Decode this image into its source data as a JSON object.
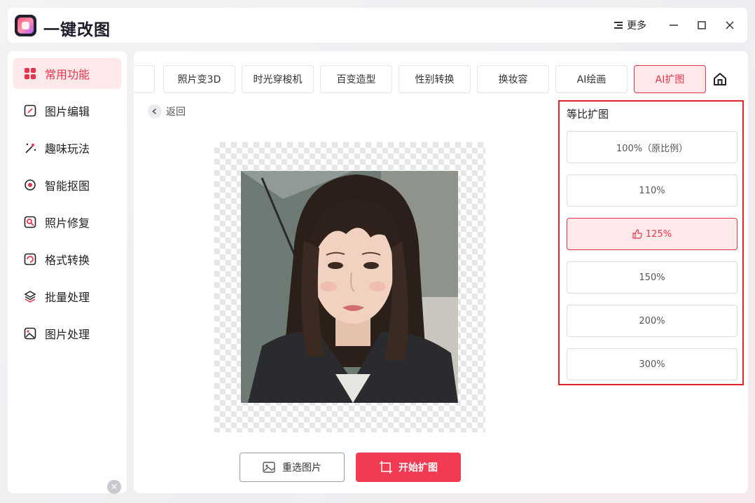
{
  "app": {
    "name": "一键改图",
    "more_label": "更多"
  },
  "sidebar": {
    "items": [
      {
        "label": "常用功能",
        "icon": "grid-icon",
        "active": true
      },
      {
        "label": "图片编辑",
        "icon": "edit-icon"
      },
      {
        "label": "趣味玩法",
        "icon": "magic-wand-icon"
      },
      {
        "label": "智能抠图",
        "icon": "target-icon"
      },
      {
        "label": "照片修复",
        "icon": "repair-icon"
      },
      {
        "label": "格式转换",
        "icon": "convert-icon"
      },
      {
        "label": "批量处理",
        "icon": "layers-icon"
      },
      {
        "label": "图片处理",
        "icon": "image-icon"
      }
    ]
  },
  "tabs": [
    {
      "label": "照片变3D"
    },
    {
      "label": "时光穿梭机"
    },
    {
      "label": "百变造型"
    },
    {
      "label": "性别转换"
    },
    {
      "label": "换妆容"
    },
    {
      "label": "AI绘画"
    },
    {
      "label": "AI扩图",
      "active": true
    }
  ],
  "back_label": "返回",
  "buttons": {
    "reselect": "重选图片",
    "start": "开始扩图"
  },
  "ratio_panel": {
    "title": "等比扩图",
    "options": [
      {
        "label": "100%（原比例）"
      },
      {
        "label": "110%"
      },
      {
        "label": "125%",
        "selected": true,
        "icon": "thumbs-up-icon"
      },
      {
        "label": "150%"
      },
      {
        "label": "200%"
      },
      {
        "label": "300%"
      }
    ]
  },
  "colors": {
    "accent": "#f23b52",
    "highlight_border": "#e4242b"
  }
}
